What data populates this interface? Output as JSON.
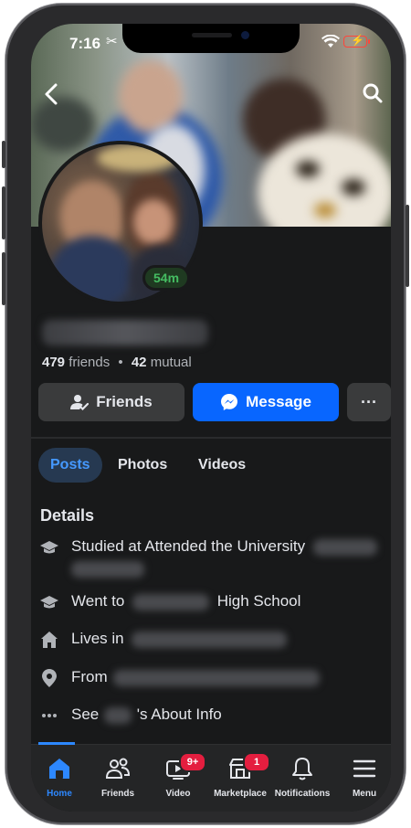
{
  "status_bar": {
    "time": "7:16"
  },
  "profile": {
    "active_status": "54m",
    "friends_count": "479",
    "friends_label": "friends",
    "separator": "•",
    "mutual_count": "42",
    "mutual_label": "mutual"
  },
  "actions": {
    "friends_label": "Friends",
    "message_label": "Message",
    "more_label": "···"
  },
  "tabs": [
    {
      "label": "Posts",
      "active": true
    },
    {
      "label": "Photos",
      "active": false
    },
    {
      "label": "Videos",
      "active": false
    }
  ],
  "details": {
    "title": "Details",
    "items": [
      {
        "icon": "graduation-cap-icon",
        "prefix": "Studied at Attended the University",
        "suffix": ""
      },
      {
        "icon": "graduation-cap-icon",
        "prefix": "Went to",
        "suffix": "High School"
      },
      {
        "icon": "home-icon",
        "prefix": "Lives in",
        "suffix": ""
      },
      {
        "icon": "location-pin-icon",
        "prefix": "From",
        "suffix": ""
      },
      {
        "icon": "more-dots-icon",
        "prefix": "See",
        "suffix": "'s About Info"
      }
    ]
  },
  "bottom_nav": [
    {
      "label": "Home",
      "icon": "home-icon",
      "active": true,
      "badge": ""
    },
    {
      "label": "Friends",
      "icon": "friends-icon",
      "active": false,
      "badge": ""
    },
    {
      "label": "Video",
      "icon": "video-icon",
      "active": false,
      "badge": "9+"
    },
    {
      "label": "Marketplace",
      "icon": "marketplace-icon",
      "active": false,
      "badge": "1"
    },
    {
      "label": "Notifications",
      "icon": "bell-icon",
      "active": false,
      "badge": ""
    },
    {
      "label": "Menu",
      "icon": "menu-icon",
      "active": false,
      "badge": ""
    }
  ],
  "colors": {
    "background": "#18191a",
    "accent": "#0866ff",
    "active_tab_bg": "#263951",
    "active_status": "#45bd62",
    "badge": "#e41e3f"
  }
}
